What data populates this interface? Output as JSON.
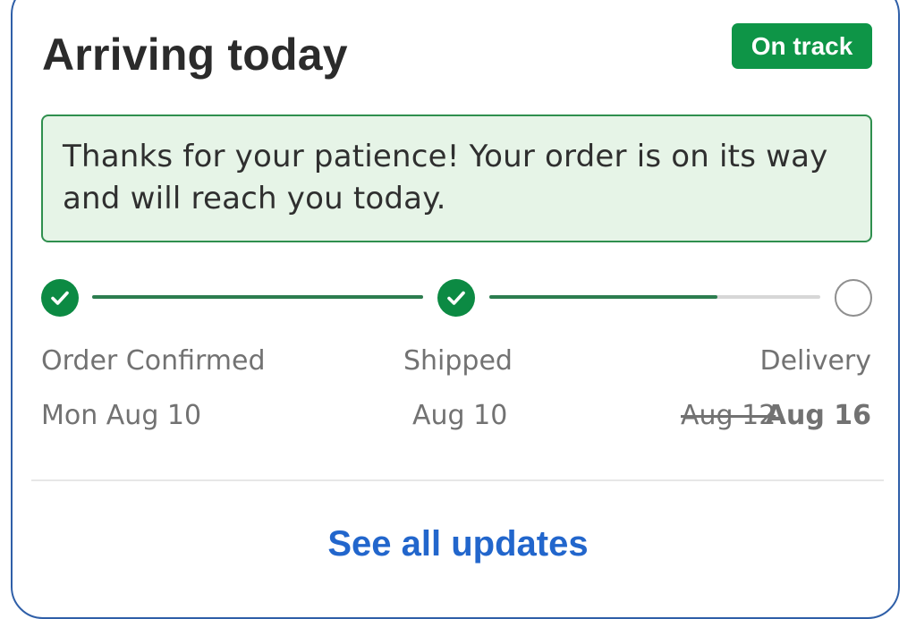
{
  "card": {
    "title": "Arriving today",
    "status_badge": "On track",
    "notice": "Thanks for your patience! Your order is on its way and will reach you today."
  },
  "progress": {
    "steps": [
      {
        "label": "Order Confirmed",
        "date": "Mon Aug 10",
        "state": "complete",
        "icon": "check-icon"
      },
      {
        "label": "Shipped",
        "date": "Aug 10",
        "state": "complete",
        "icon": "check-icon"
      },
      {
        "label": "Delivery",
        "original_date": "Aug 12",
        "date": "Aug 16",
        "state": "pending",
        "icon": "empty-circle-icon"
      }
    ],
    "segment_fill": [
      1.0,
      0.69
    ]
  },
  "footer": {
    "link_label": "See all updates"
  },
  "colors": {
    "accent_green": "#0e9547",
    "link_blue": "#2266cc",
    "card_border": "#2f5fa8",
    "notice_bg": "#e6f4e7"
  }
}
